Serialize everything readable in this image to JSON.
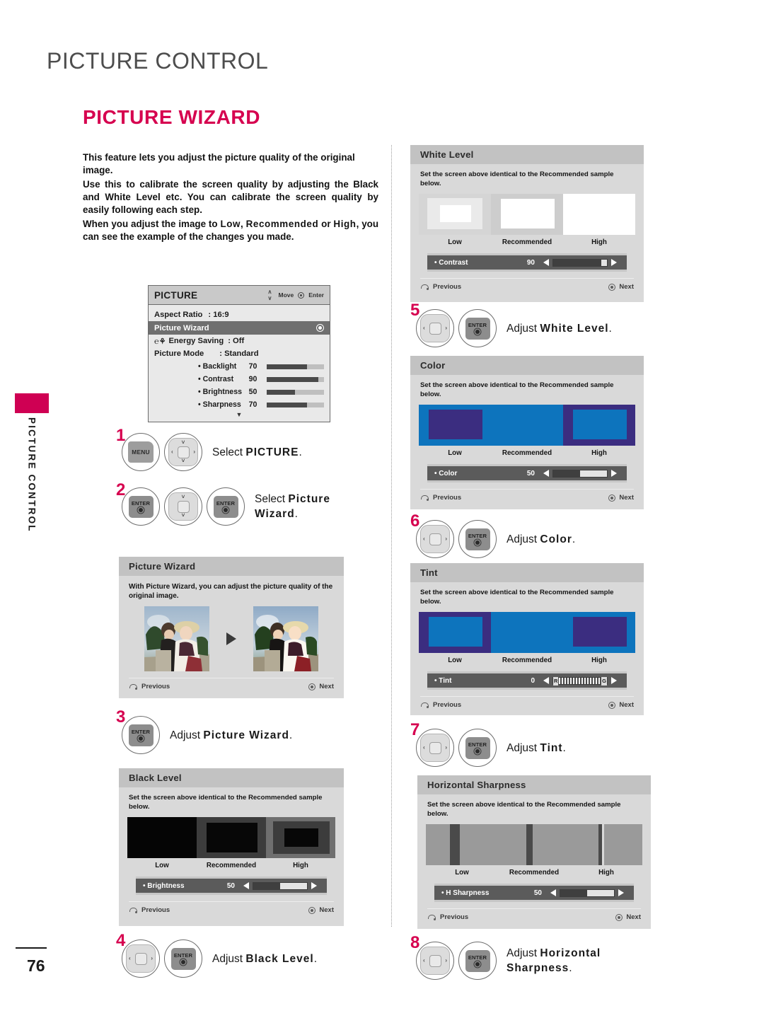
{
  "chapter_title": "PICTURE CONTROL",
  "section_title": "PICTURE WIZARD",
  "side_tab_label": "PICTURE CONTROL",
  "page_number": "76",
  "accent_color": "#d6004f",
  "intro": {
    "p1": "This feature lets you adjust the picture quality of the original image.",
    "p2": "Use this to calibrate the screen quality by adjusting the Black and White Level etc. You can calibrate the screen quality by easily following each step.",
    "p3_a": "When you adjust the image to ",
    "p3_low": "Low",
    "p3_b": ", ",
    "p3_rec": "Recommended",
    "p3_c": " or ",
    "p3_high": "High",
    "p3_d": ", you can see the example of the changes you made."
  },
  "osd_picture": {
    "title": "PICTURE",
    "hint_move": "Move",
    "hint_enter": "Enter",
    "rows": [
      {
        "label": "Aspect Ratio",
        "value": ": 16:9"
      },
      {
        "label": "Picture Wizard",
        "value": ""
      },
      {
        "label": "Energy Saving",
        "value": ": Off"
      },
      {
        "label": "Picture Mode",
        "value": ": Standard"
      }
    ],
    "sliders": [
      {
        "name": "• Backlight",
        "value": "70",
        "pct": 70
      },
      {
        "name": "• Contrast",
        "value": "90",
        "pct": 90
      },
      {
        "name": "• Brightness",
        "value": "50",
        "pct": 50
      },
      {
        "name": "• Sharpness",
        "value": "70",
        "pct": 70
      }
    ]
  },
  "panels": {
    "wizard": {
      "title": "Picture Wizard",
      "desc": "With Picture Wizard, you can adjust the picture quality of the original image.",
      "previous": "Previous",
      "next": "Next"
    },
    "black_level": {
      "title": "Black Level",
      "desc": "Set the screen above identical to the Recommended sample below.",
      "samples": [
        "Low",
        "Recommended",
        "High"
      ],
      "slider": {
        "name": "• Brightness",
        "value": "50",
        "pct": 50
      },
      "previous": "Previous",
      "next": "Next"
    },
    "white_level": {
      "title": "White Level",
      "desc": "Set the screen above identical to the Recommended sample below.",
      "samples": [
        "Low",
        "Recommended",
        "High"
      ],
      "slider": {
        "name": "• Contrast",
        "value": "90",
        "pct": 90
      },
      "previous": "Previous",
      "next": "Next"
    },
    "color": {
      "title": "Color",
      "desc": "Set the screen above identical to the Recommended sample below.",
      "samples": [
        "Low",
        "Recommended",
        "High"
      ],
      "slider": {
        "name": "• Color",
        "value": "50",
        "pct": 50
      },
      "previous": "Previous",
      "next": "Next"
    },
    "tint": {
      "title": "Tint",
      "desc": "Set the screen above identical to the Recommended sample below.",
      "samples": [
        "Low",
        "Recommended",
        "High"
      ],
      "slider": {
        "name": "• Tint",
        "value": "0",
        "left_mark": "R",
        "right_mark": "G"
      },
      "previous": "Previous",
      "next": "Next"
    },
    "h_sharpness": {
      "title": "Horizontal Sharpness",
      "desc": "Set the screen above identical to the Recommended sample below.",
      "samples": [
        "Low",
        "Recommended",
        "High"
      ],
      "slider": {
        "name": "• H Sharpness",
        "value": "50",
        "pct": 50
      },
      "previous": "Previous",
      "next": "Next"
    }
  },
  "keys": {
    "menu": "MENU",
    "enter": "ENTER"
  },
  "steps": {
    "s1": {
      "num": "1",
      "text_a": "Select ",
      "text_b": "PICTURE",
      "text_c": "."
    },
    "s2": {
      "num": "2",
      "text_a": "Select ",
      "text_b": "Picture Wizard",
      "text_c": "."
    },
    "s3": {
      "num": "3",
      "text_a": "Adjust ",
      "text_b": "Picture Wizard",
      "text_c": "."
    },
    "s4": {
      "num": "4",
      "text_a": "Adjust ",
      "text_b": "Black Level",
      "text_c": "."
    },
    "s5": {
      "num": "5",
      "text_a": "Adjust ",
      "text_b": "White Level",
      "text_c": "."
    },
    "s6": {
      "num": "6",
      "text_a": "Adjust ",
      "text_b": "Color",
      "text_c": "."
    },
    "s7": {
      "num": "7",
      "text_a": "Adjust ",
      "text_b": "Tint",
      "text_c": "."
    },
    "s8": {
      "num": "8",
      "text_a": "Adjust ",
      "text_b": "Horizontal Sharpness",
      "text_c": "."
    }
  }
}
